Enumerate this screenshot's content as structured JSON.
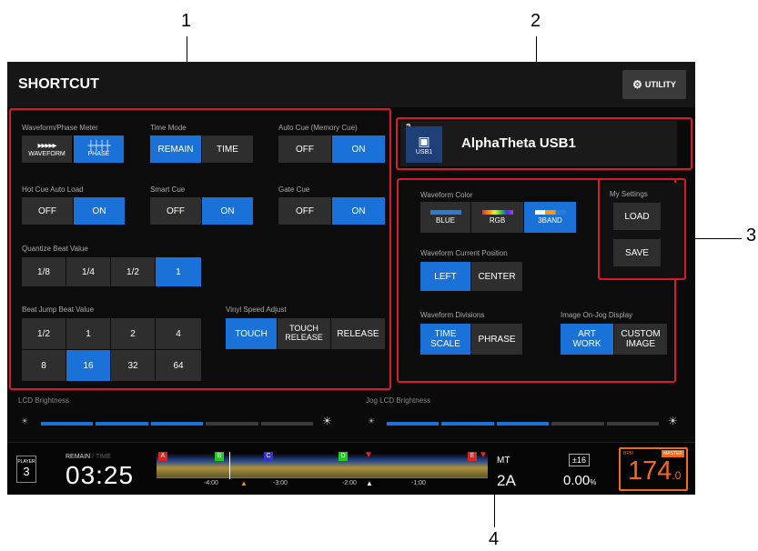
{
  "callouts": [
    "1",
    "2",
    "3",
    "4"
  ],
  "header": {
    "title": "SHORTCUT",
    "utility_label": "UTILITY",
    "utility_icon": "gear-icon"
  },
  "left_panel": {
    "waveform_phase": {
      "label": "Waveform/Phase Meter",
      "options": [
        "WAVEFORM",
        "PHASE"
      ],
      "selected": "PHASE"
    },
    "time_mode": {
      "label": "Time Mode",
      "options": [
        "REMAIN",
        "TIME"
      ],
      "selected": "REMAIN"
    },
    "auto_cue": {
      "label": "Auto Cue (Memory Cue)",
      "options": [
        "OFF",
        "ON"
      ],
      "selected": "ON"
    },
    "hot_cue_auto_load": {
      "label": "Hot Cue Auto Load",
      "options": [
        "OFF",
        "ON"
      ],
      "selected": "ON"
    },
    "smart_cue": {
      "label": "Smart Cue",
      "options": [
        "OFF",
        "ON"
      ],
      "selected": "ON"
    },
    "gate_cue": {
      "label": "Gate Cue",
      "options": [
        "OFF",
        "ON"
      ],
      "selected": "ON"
    },
    "quantize": {
      "label": "Quantize Beat Value",
      "options": [
        "1/8",
        "1/4",
        "1/2",
        "1"
      ],
      "selected": "1"
    },
    "beat_jump": {
      "label": "Beat Jump Beat Value",
      "row1": [
        "1/2",
        "1",
        "2",
        "4"
      ],
      "row2": [
        "8",
        "16",
        "32",
        "64"
      ],
      "selected": "16"
    },
    "vinyl_speed": {
      "label": "Vinyl Speed Adjust",
      "opt1": "TOUCH",
      "opt2_line1": "TOUCH",
      "opt2_line2": "RELEASE",
      "opt3": "RELEASE",
      "selected": "TOUCH"
    }
  },
  "device": {
    "slot": "3",
    "media_label": "USB1",
    "name": "AlphaTheta USB1",
    "icon": "usb-icon"
  },
  "right_panel": {
    "waveform_color": {
      "label": "Waveform Color",
      "options": [
        "BLUE",
        "RGB",
        "3BAND"
      ],
      "selected": "3BAND"
    },
    "waveform_position": {
      "label": "Waveform Current Position",
      "options": [
        "LEFT",
        "CENTER"
      ],
      "selected": "LEFT"
    },
    "waveform_divisions": {
      "label": "Waveform Divisions",
      "opt1_line1": "TIME",
      "opt1_line2": "SCALE",
      "opt2": "PHRASE",
      "selected": "TIME SCALE"
    },
    "image_on_jog": {
      "label": "Image On-Jog Display",
      "opt1_line1": "ART",
      "opt1_line2": "WORK",
      "opt2_line1": "CUSTOM",
      "opt2_line2": "IMAGE",
      "selected": "ART WORK"
    }
  },
  "my_settings": {
    "label": "My Settings",
    "load": "LOAD",
    "save": "SAVE"
  },
  "brightness": {
    "lcd_label": "LCD Brightness",
    "lcd_level": 3,
    "lcd_max": 5,
    "jog_label": "Jog LCD Brightness",
    "jog_level": 3,
    "jog_max": 5
  },
  "status_bar": {
    "player_label": "PLAYER",
    "player_num": "3",
    "remain_label": "REMAIN",
    "time_label": "TIME",
    "time_value": "03:25",
    "cue_markers": [
      "A",
      "B",
      "C",
      "D",
      "E"
    ],
    "ticks": [
      "-4:00",
      "-3:00",
      "-2:00",
      "-1:00"
    ],
    "mt": "MT",
    "key": "2A",
    "range": "±16",
    "tempo_value": "0.00",
    "tempo_unit": "%",
    "bpm_label": "BPM",
    "master_label": "MASTER",
    "bpm_int": "174",
    "bpm_dec": ".0"
  },
  "colors": {
    "accent": "#1a72d9",
    "callout_red": "#d81a2a",
    "bpm_orange": "#f06a1a"
  }
}
